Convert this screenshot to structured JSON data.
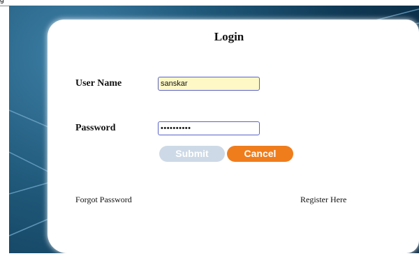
{
  "page": {
    "corner_glyph": "g"
  },
  "login": {
    "title": "Login",
    "username_label": "User Name",
    "username_value": "sanskar",
    "password_label": "Password",
    "password_value": "••••••••••",
    "submit_label": "Submit",
    "cancel_label": "Cancel",
    "forgot_label": "Forgot Password",
    "register_label": "Register Here"
  },
  "colors": {
    "background": "#1f5879",
    "username_fill": "#fdf8c6",
    "input_border": "#5a63c9",
    "submit": "#cdd9e6",
    "cancel": "#ef7d1c"
  }
}
